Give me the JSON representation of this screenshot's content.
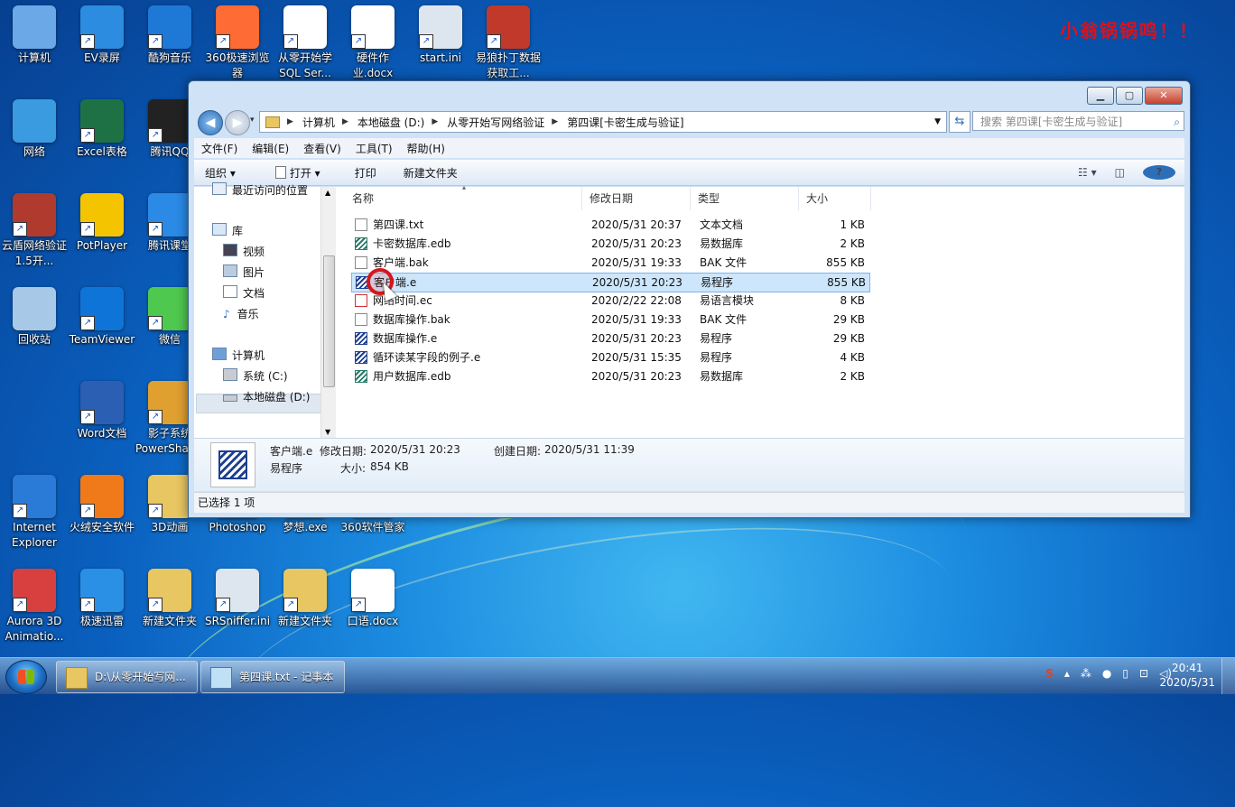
{
  "watermark": "小翁锅锅鸣！！",
  "desktop_icons": [
    {
      "name": "computer",
      "label": "计算机"
    },
    {
      "name": "ev",
      "label": "EV录屏"
    },
    {
      "name": "kugou",
      "label": "酷狗音乐"
    },
    {
      "name": "browser360",
      "label": "360极速浏览器"
    },
    {
      "name": "sql",
      "label": "从零开始学SQL Ser..."
    },
    {
      "name": "docx1",
      "label": "硬件作业.docx"
    },
    {
      "name": "startini",
      "label": "start.ini"
    },
    {
      "name": "yilang",
      "label": "易狼扑丁数据获取工..."
    },
    {
      "name": "network",
      "label": "网络"
    },
    {
      "name": "excel",
      "label": "Excel表格"
    },
    {
      "name": "qq",
      "label": "腾讯QQ"
    },
    {
      "name": "yunyin",
      "label": "云盾网络验证1.5开..."
    },
    {
      "name": "potplayer",
      "label": "PotPlayer"
    },
    {
      "name": "ketang",
      "label": "腾讯课堂"
    },
    {
      "name": "recycle",
      "label": "回收站"
    },
    {
      "name": "teamviewer",
      "label": "TeamViewer"
    },
    {
      "name": "wechat",
      "label": "微信"
    },
    {
      "name": "word",
      "label": "Word文档"
    },
    {
      "name": "yingzi",
      "label": "影子系统PowerShadow"
    },
    {
      "name": "ie",
      "label": "Internet Explorer"
    },
    {
      "name": "huorong",
      "label": "火绒安全软件"
    },
    {
      "name": "anim3d",
      "label": "3D动画"
    },
    {
      "name": "photoshop",
      "label": "Photoshop"
    },
    {
      "name": "mengxiang",
      "label": "梦想.exe"
    },
    {
      "name": "soft360",
      "label": "360软件管家"
    },
    {
      "name": "aurora",
      "label": "Aurora 3D Animatio..."
    },
    {
      "name": "xunlei",
      "label": "极速迅雷"
    },
    {
      "name": "newfolder1",
      "label": "新建文件夹"
    },
    {
      "name": "srsniffer",
      "label": "SRSniffer.ini"
    },
    {
      "name": "newfolder2",
      "label": "新建文件夹"
    },
    {
      "name": "kouyu",
      "label": "口语.docx"
    }
  ],
  "explorer": {
    "address": [
      "计算机",
      "本地磁盘 (D:)",
      "从零开始写网络验证",
      "第四课[卡密生成与验证]"
    ],
    "search_placeholder": "搜索 第四课[卡密生成与验证]",
    "menu": [
      "文件(F)",
      "编辑(E)",
      "查看(V)",
      "工具(T)",
      "帮助(H)"
    ],
    "toolbar": {
      "organize": "组织 ▾",
      "open": "打开 ▾",
      "print": "打印",
      "new_folder": "新建文件夹"
    },
    "nav": {
      "recent": "最近访问的位置",
      "libraries": "库",
      "videos": "视频",
      "pictures": "图片",
      "documents": "文档",
      "music": "音乐",
      "computer": "计算机",
      "drive_c": "系统 (C:)",
      "drive_d": "本地磁盘 (D:)"
    },
    "columns": {
      "name": "名称",
      "date": "修改日期",
      "type": "类型",
      "size": "大小"
    },
    "files": [
      {
        "name": "第四课.txt",
        "date": "2020/5/31 20:37",
        "type": "文本文档",
        "size": "1 KB",
        "icon": "txt"
      },
      {
        "name": "卡密数据库.edb",
        "date": "2020/5/31 20:23",
        "type": "易数据库",
        "size": "2 KB",
        "icon": "edb"
      },
      {
        "name": "客户端.bak",
        "date": "2020/5/31 19:33",
        "type": "BAK 文件",
        "size": "855 KB",
        "icon": "txt"
      },
      {
        "name": "客户端.e",
        "date": "2020/5/31 20:23",
        "type": "易程序",
        "size": "855 KB",
        "icon": "e"
      },
      {
        "name": "网络时间.ec",
        "date": "2020/2/22 22:08",
        "type": "易语言模块",
        "size": "8 KB",
        "icon": "ec"
      },
      {
        "name": "数据库操作.bak",
        "date": "2020/5/31 19:33",
        "type": "BAK 文件",
        "size": "29 KB",
        "icon": "txt"
      },
      {
        "name": "数据库操作.e",
        "date": "2020/5/31 20:23",
        "type": "易程序",
        "size": "29 KB",
        "icon": "e"
      },
      {
        "name": "循环读某字段的例子.e",
        "date": "2020/5/31 15:35",
        "type": "易程序",
        "size": "4 KB",
        "icon": "e"
      },
      {
        "name": "用户数据库.edb",
        "date": "2020/5/31 20:23",
        "type": "易数据库",
        "size": "2 KB",
        "icon": "edb"
      }
    ],
    "details": {
      "filename": "客户端.e",
      "modified_label": "修改日期:",
      "modified": "2020/5/31 20:23",
      "created_label": "创建日期:",
      "created": "2020/5/31 11:39",
      "type": "易程序",
      "size_label": "大小:",
      "size": "854 KB"
    },
    "status": "已选择 1 项"
  },
  "taskbar": {
    "items": [
      "D:\\从零开始写网...",
      "第四课.txt - 记事本"
    ],
    "time": "20:41",
    "date": "2020/5/31"
  }
}
